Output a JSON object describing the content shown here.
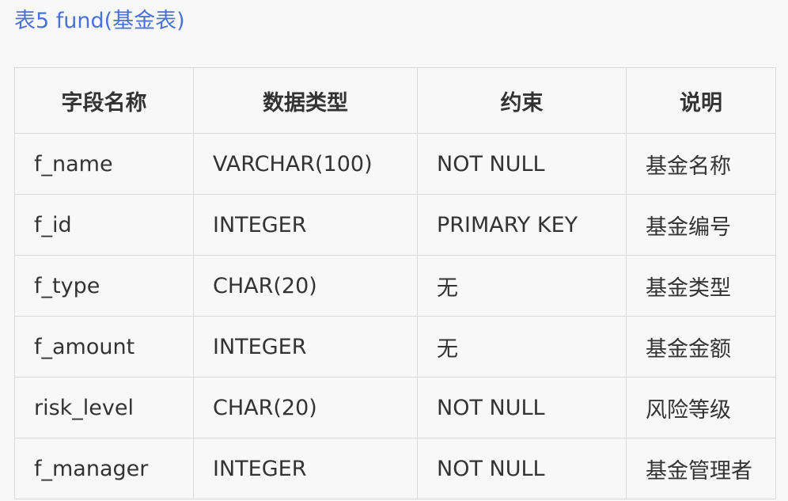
{
  "caption": "表5 fund(基金表)",
  "table": {
    "headers": [
      "字段名称",
      "数据类型",
      "约束",
      "说明"
    ],
    "rows": [
      [
        "f_name",
        "VARCHAR(100)",
        "NOT NULL",
        "基金名称"
      ],
      [
        "f_id",
        "INTEGER",
        "PRIMARY KEY",
        "基金编号"
      ],
      [
        "f_type",
        "CHAR(20)",
        "无",
        "基金类型"
      ],
      [
        "f_amount",
        "INTEGER",
        "无",
        "基金金额"
      ],
      [
        "risk_level",
        "CHAR(20)",
        "NOT NULL",
        "风险等级"
      ],
      [
        "f_manager",
        "INTEGER",
        "NOT NULL",
        "基金管理者"
      ]
    ]
  },
  "colors": {
    "caption": "#4a72d6",
    "background": "#f8f8f8",
    "border": "#d9d9d9",
    "text": "#333333"
  }
}
